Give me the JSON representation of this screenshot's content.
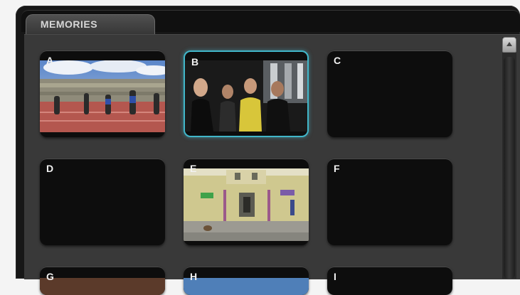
{
  "tab": {
    "label": "MEMORIES"
  },
  "slots": [
    {
      "letter": "A",
      "image": "sprinters-on-track",
      "selected": false
    },
    {
      "letter": "B",
      "image": "people-in-dark-street",
      "selected": true
    },
    {
      "letter": "C",
      "image": "",
      "selected": false
    },
    {
      "letter": "D",
      "image": "",
      "selected": false
    },
    {
      "letter": "E",
      "image": "yellow-building-street",
      "selected": false
    },
    {
      "letter": "F",
      "image": "",
      "selected": false
    },
    {
      "letter": "G",
      "image": "",
      "selected": false
    },
    {
      "letter": "H",
      "image": "",
      "selected": false
    },
    {
      "letter": "I",
      "image": "",
      "selected": false
    }
  ],
  "scrollbar": {
    "up_icon": "chevron-up-icon"
  },
  "colors": {
    "selection": "#41b6c9",
    "panel": "#393939",
    "slot": "#0d0d0d"
  }
}
